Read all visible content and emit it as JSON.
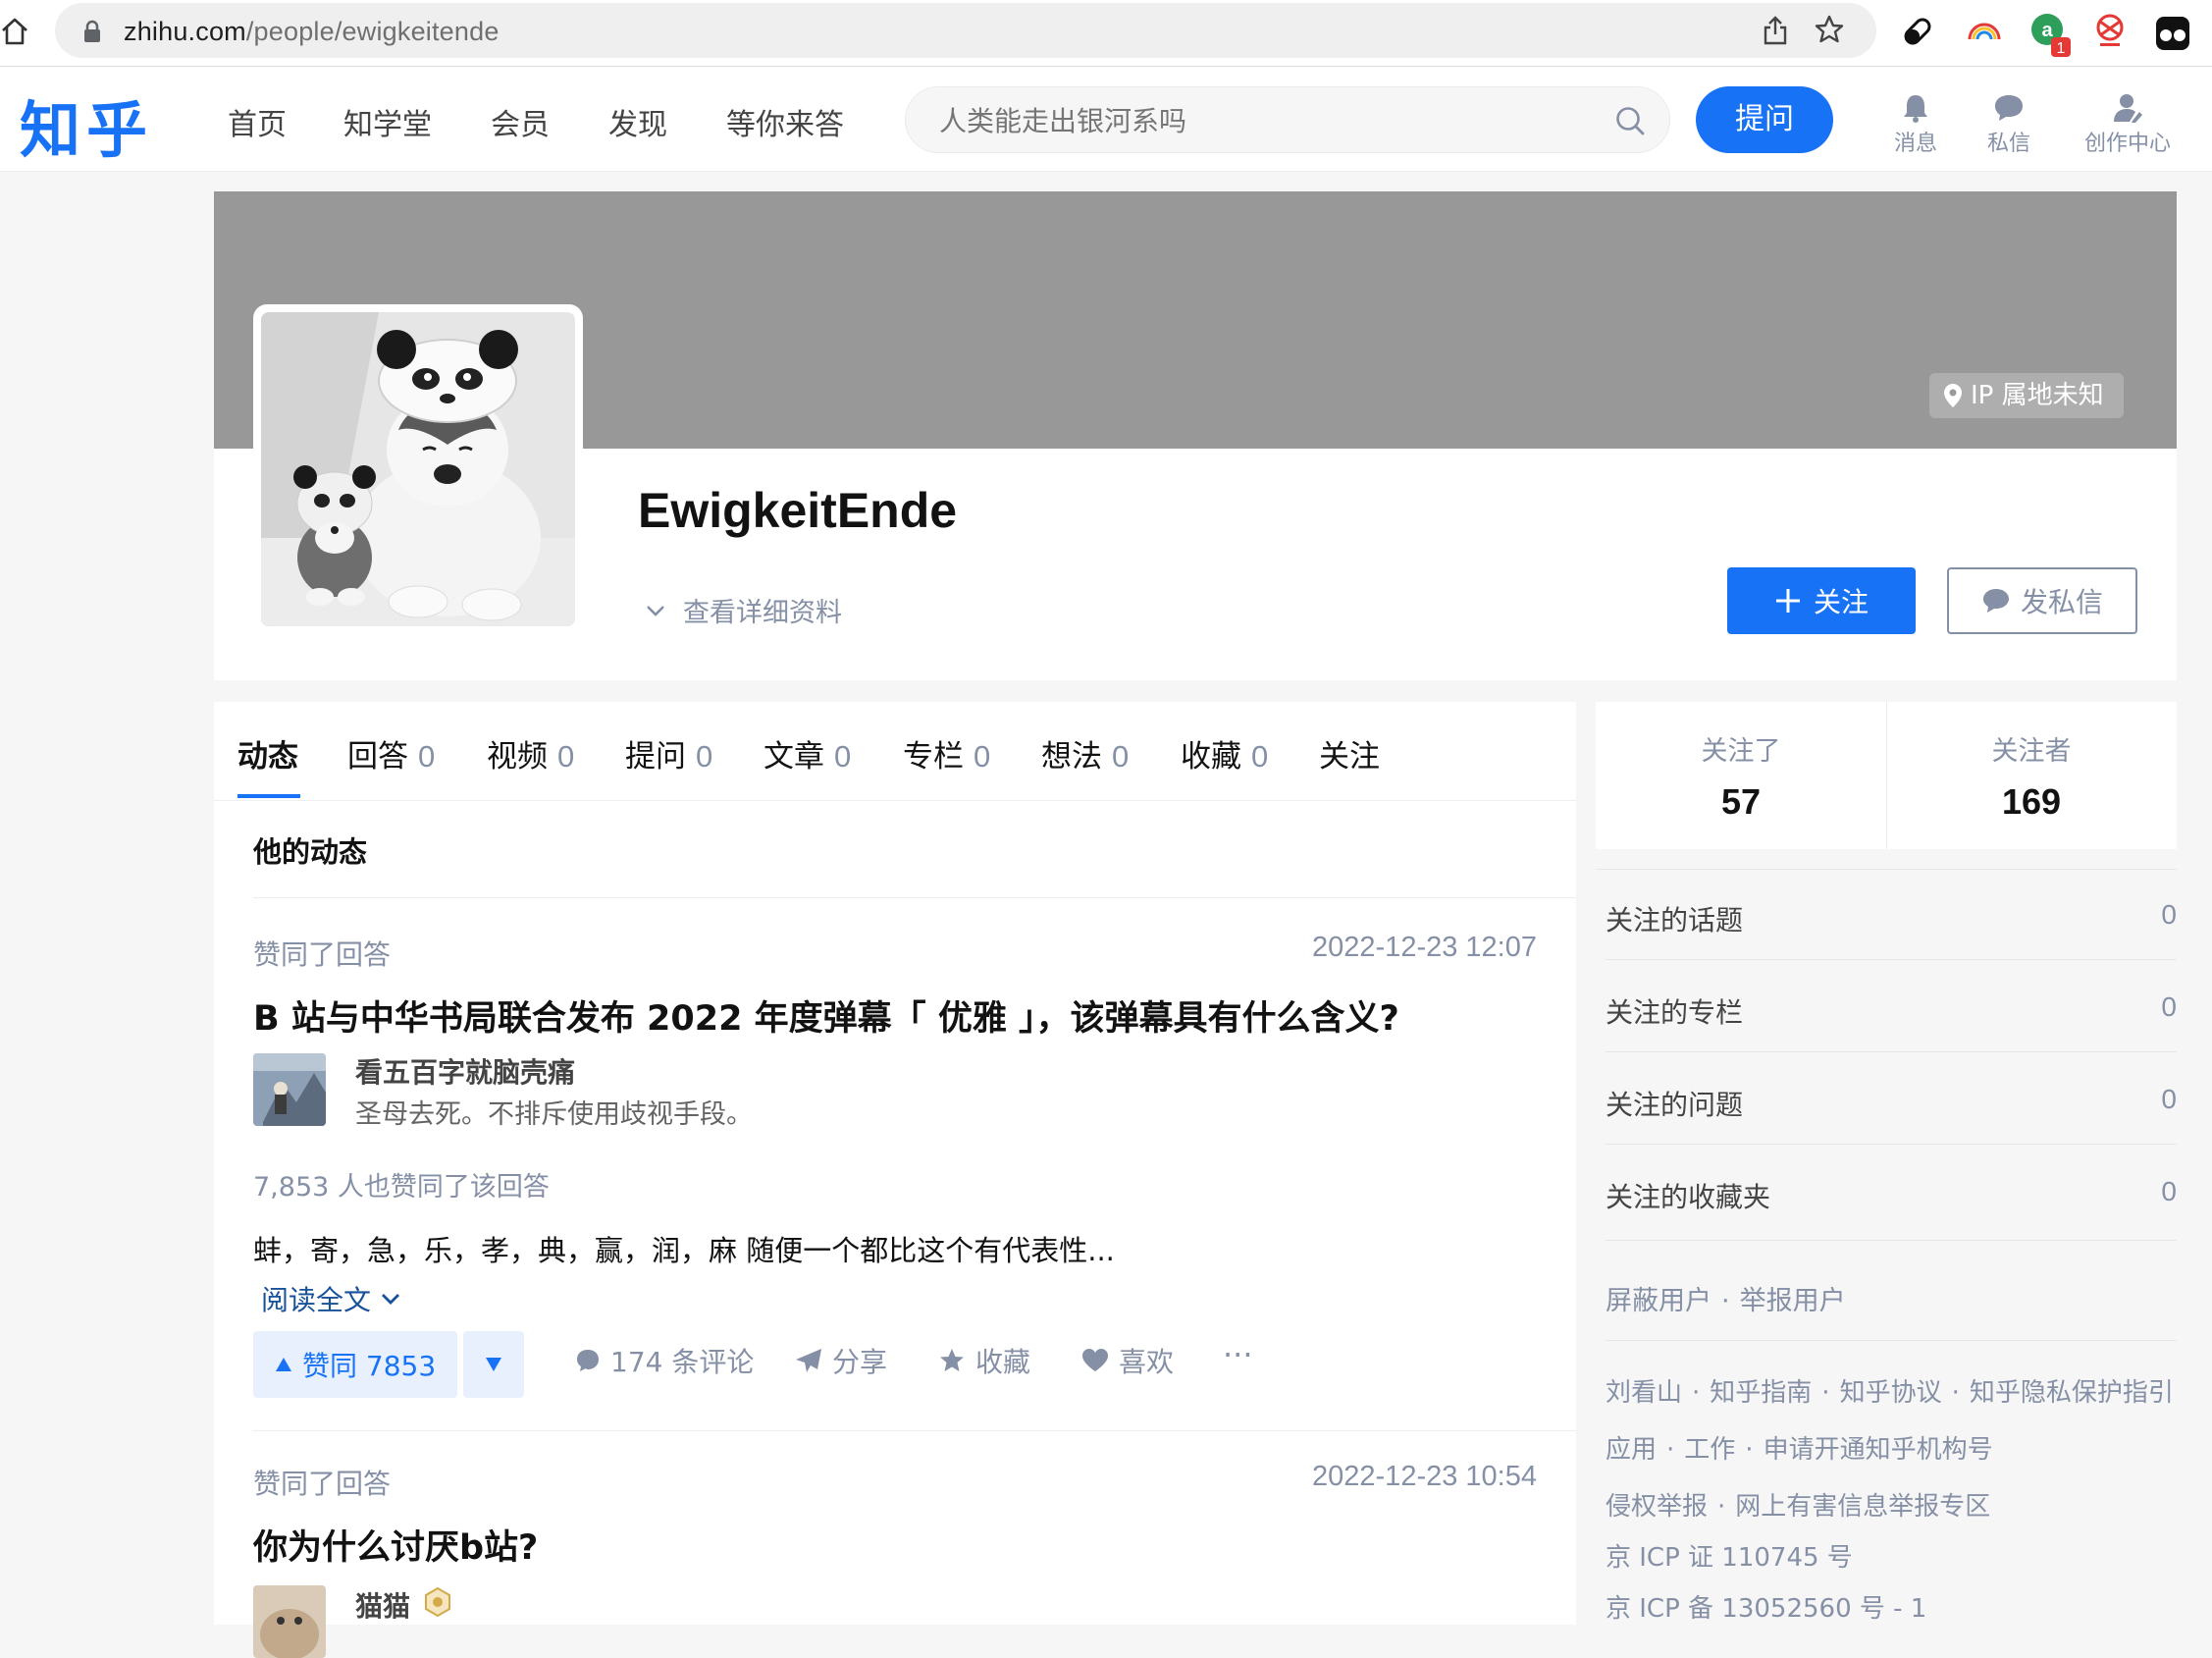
{
  "browser": {
    "url_host": "zhihu.com",
    "url_path": "/people/ewigkeitende",
    "extension_badge": "1"
  },
  "header": {
    "logo": "知乎",
    "nav": [
      "首页",
      "知学堂",
      "会员",
      "发现",
      "等你来答"
    ],
    "search_placeholder": "人类能走出银河系吗",
    "ask_label": "提问",
    "actions": {
      "messages": "消息",
      "private": "私信",
      "creator": "创作中心"
    }
  },
  "profile": {
    "ip_location": "IP 属地未知",
    "name": "EwigkeitEnde",
    "detail_link": "查看详细资料",
    "follow_label": "关注",
    "message_label": "发私信"
  },
  "tabs": [
    {
      "label": "动态",
      "count": ""
    },
    {
      "label": "回答",
      "count": "0"
    },
    {
      "label": "视频",
      "count": "0"
    },
    {
      "label": "提问",
      "count": "0"
    },
    {
      "label": "文章",
      "count": "0"
    },
    {
      "label": "专栏",
      "count": "0"
    },
    {
      "label": "想法",
      "count": "0"
    },
    {
      "label": "收藏",
      "count": "0"
    },
    {
      "label": "关注",
      "count": ""
    }
  ],
  "feed": {
    "section_title": "他的动态",
    "items": [
      {
        "action": "赞同了回答",
        "time": "2022-12-23 12:07",
        "question": "B 站与中华书局联合发布 2022 年度弹幕「 优雅 」，该弹幕具有什么含义?",
        "author_name": "看五百字就脑壳痛",
        "author_bio": "圣母去死。不排斥使用歧视手段。",
        "vote_meta": "7,853 人也赞同了该回答",
        "excerpt": "蚌，寄，急，乐，孝，典，赢，润，麻 随便一个都比这个有代表性...",
        "read_more": "阅读全文",
        "upvote": "赞同 7853",
        "comments": "174 条评论",
        "share": "分享",
        "collect": "收藏",
        "like": "喜欢",
        "more": "···"
      },
      {
        "action": "赞同了回答",
        "time": "2022-12-23 10:54",
        "question": "你为什么讨厌b站?",
        "author_name": "猫猫"
      }
    ]
  },
  "sidebar": {
    "following_label": "关注了",
    "following_count": "57",
    "followers_label": "关注者",
    "followers_count": "169",
    "rows": [
      {
        "label": "关注的话题",
        "value": "0"
      },
      {
        "label": "关注的专栏",
        "value": "0"
      },
      {
        "label": "关注的问题",
        "value": "0"
      },
      {
        "label": "关注的收藏夹",
        "value": "0"
      }
    ],
    "block_user": "屏蔽用户",
    "report_user": "举报用户",
    "footer_line1": [
      "刘看山",
      "知乎指南",
      "知乎协议",
      "知乎隐私保护指引"
    ],
    "footer_line2": [
      "应用",
      "工作",
      "申请开通知乎机构号"
    ],
    "footer_line3": [
      "侵权举报",
      "网上有害信息举报专区"
    ],
    "footer_line4": "京 ICP 证 110745 号",
    "footer_line5": "京 ICP 备 13052560 号 - 1"
  },
  "colors": {
    "brand": "#1772f6",
    "muted": "#8590a6",
    "cover": "#989898"
  }
}
